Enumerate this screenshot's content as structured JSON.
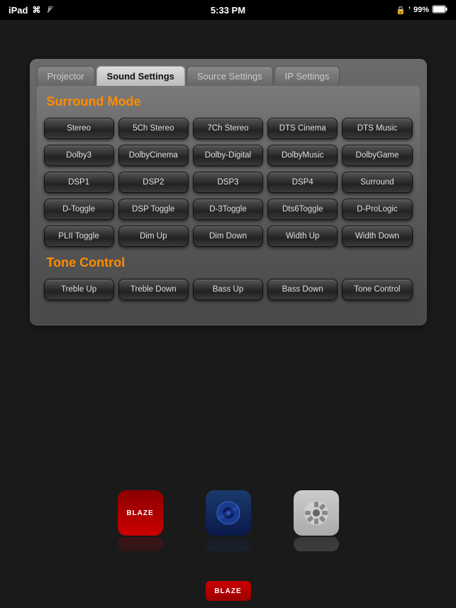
{
  "statusBar": {
    "device": "iPad",
    "time": "5:33 PM",
    "battery": "99%",
    "wifi": true,
    "bluetooth": true
  },
  "tabs": [
    {
      "id": "projector",
      "label": "Projector",
      "active": false
    },
    {
      "id": "sound",
      "label": "Sound Settings",
      "active": true
    },
    {
      "id": "source",
      "label": "Source Settings",
      "active": false
    },
    {
      "id": "ip",
      "label": "IP Settings",
      "active": false
    }
  ],
  "sections": [
    {
      "id": "surround",
      "title": "Surround Mode",
      "rows": [
        [
          "Stereo",
          "5Ch Stereo",
          "7Ch Stereo",
          "DTS Cinema",
          "DTS Music"
        ],
        [
          "Dolby3",
          "DolbyCinema",
          "Dolby-Digital",
          "DolbyMusic",
          "DolbyGame"
        ],
        [
          "DSP1",
          "DSP2",
          "DSP3",
          "DSP4",
          "Surround"
        ],
        [
          "D-Toggle",
          "DSP Toggle",
          "D-3Toggle",
          "Dts6Toggle",
          "D-ProLogic"
        ],
        [
          "PLII Toggle",
          "Dim Up",
          "Dim Down",
          "Width Up",
          "Width Down"
        ]
      ]
    },
    {
      "id": "tone",
      "title": "Tone Control",
      "rows": [
        [
          "Treble Up",
          "Treble Down",
          "Bass Up",
          "Bass Down",
          "Tone Control"
        ]
      ]
    }
  ],
  "dock": {
    "icons": [
      {
        "id": "blaze-app",
        "type": "blaze",
        "label": "BLAZE"
      },
      {
        "id": "bluray-app",
        "type": "bluray",
        "label": ""
      },
      {
        "id": "settings-app",
        "type": "gear",
        "label": ""
      }
    ]
  },
  "homeButton": {
    "label": "BLAZE"
  }
}
